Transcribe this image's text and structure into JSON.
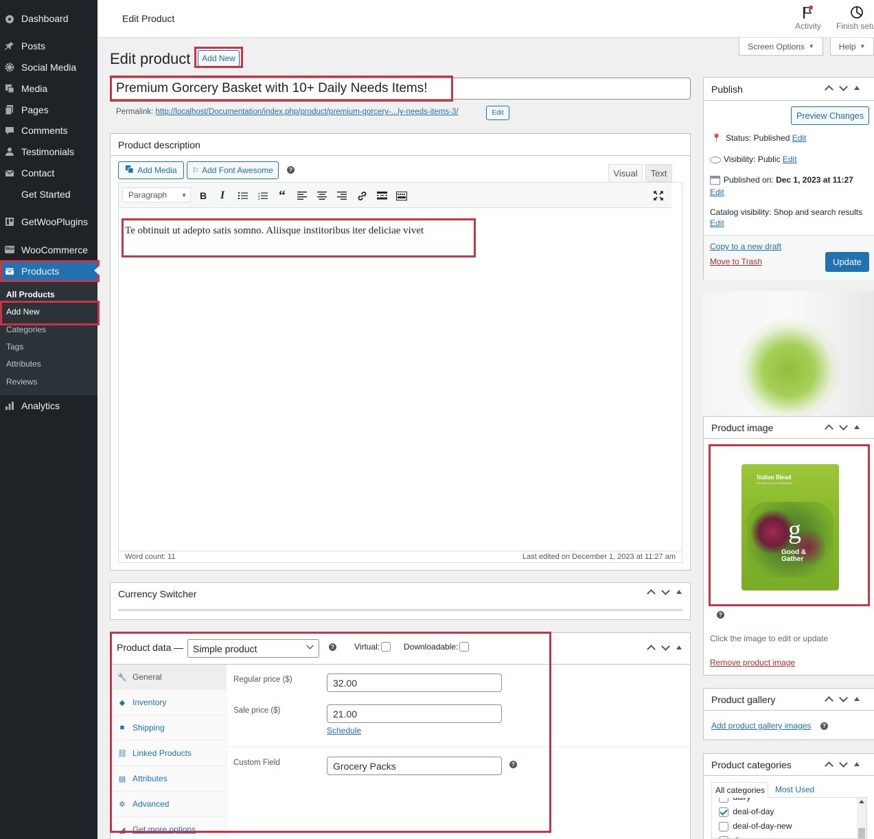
{
  "sidebar": {
    "items": [
      {
        "label": "Dashboard",
        "icon": "dashboard-icon"
      },
      {
        "label": "Posts",
        "icon": "pin-icon"
      },
      {
        "label": "Social Media",
        "icon": "gear-icon"
      },
      {
        "label": "Media",
        "icon": "media-icon"
      },
      {
        "label": "Pages",
        "icon": "page-icon"
      },
      {
        "label": "Comments",
        "icon": "comment-icon"
      },
      {
        "label": "Testimonials",
        "icon": "user-icon"
      },
      {
        "label": "Contact",
        "icon": "mail-icon"
      },
      {
        "label": "Get Started",
        "icon": ""
      },
      {
        "label": "GetWooPlugins",
        "icon": "plugin-icon"
      },
      {
        "label": "WooCommerce",
        "icon": "woo-icon"
      },
      {
        "label": "Products",
        "icon": "archive-icon"
      },
      {
        "label": "Analytics",
        "icon": "bar-chart-icon"
      }
    ],
    "submenu": [
      "All Products",
      "Add New",
      "Categories",
      "Tags",
      "Attributes",
      "Reviews"
    ],
    "woo_badge": "Woo"
  },
  "topbar": {
    "title": "Edit Product",
    "activity": "Activity",
    "finish_setup": "Finish setu"
  },
  "screen_options": "Screen Options",
  "help": "Help",
  "page": {
    "heading": "Edit product",
    "add_new": "Add New",
    "product_title": "Premium Gorcery Basket with 10+ Daily Needs Items!",
    "permalink_label": "Permalink:",
    "permalink_url": "http://localhost/Documentation/index.php/product/premium-gorcery-...ly-needs-items-3/",
    "permalink_edit": "Edit"
  },
  "description": {
    "title": "Product description",
    "add_media": "Add Media",
    "add_font_awesome": "Add Font Awesome",
    "tab_visual": "Visual",
    "tab_text": "Text",
    "format_select": "Paragraph",
    "content": "Te obtinuit ut adepto satis somno. Aliisque institoribus iter deliciae vivet",
    "word_count": "Word count: 11",
    "last_edited": "Last edited on December 1, 2023 at 11:27 am"
  },
  "currency_switcher": {
    "title": "Currency Switcher"
  },
  "product_data": {
    "title": "Product data —",
    "type": "Simple product",
    "virtual_label": "Virtual:",
    "downloadable_label": "Downloadable:",
    "tabs": [
      {
        "label": "General",
        "icon": "wrench-icon"
      },
      {
        "label": "Inventory",
        "icon": "tag-icon"
      },
      {
        "label": "Shipping",
        "icon": "truck-icon"
      },
      {
        "label": "Linked Products",
        "icon": "link-icon"
      },
      {
        "label": "Attributes",
        "icon": "list-icon"
      },
      {
        "label": "Advanced",
        "icon": "gear-icon"
      },
      {
        "label": "Get more options",
        "icon": "plugin-icon"
      }
    ],
    "regular_price_label": "Regular price ($)",
    "regular_price": "32.00",
    "sale_price_label": "Sale price ($)",
    "sale_price": "21.00",
    "schedule": "Schedule",
    "custom_field_label": "Custom Field",
    "custom_field": "Grocery Packs"
  },
  "publish": {
    "title": "Publish",
    "preview": "Preview Changes",
    "status_label": "Status:",
    "status": "Published",
    "visibility_label": "Visibility:",
    "visibility": "Public",
    "published_on_label": "Published on:",
    "published_on": "Dec 1, 2023 at 11:27",
    "catalog_label": "Catalog visibility:",
    "catalog": "Shop and search results",
    "edit": "Edit",
    "copy_draft": "Copy to a new draft",
    "trash": "Move to Trash",
    "update": "Update"
  },
  "product_image": {
    "title": "Product image",
    "package_brand": "Italian Blend",
    "package_sub": "Romaine Lettuce & Radicchio",
    "package_logo": "Good & Gather",
    "hint": "Click the image to edit or update",
    "remove": "Remove product image"
  },
  "gallery": {
    "title": "Product gallery",
    "add": "Add product gallery images"
  },
  "categories": {
    "title": "Product categories",
    "tab_all": "All categories",
    "tab_used": "Most Used",
    "items": [
      {
        "label": "dairy",
        "checked": false
      },
      {
        "label": "deal-of-day",
        "checked": true
      },
      {
        "label": "deal-of-day-new",
        "checked": false
      },
      {
        "label": "dinner",
        "checked": false
      }
    ]
  },
  "colors": {
    "accent": "#2271b1",
    "sidebar": "#1d2327",
    "highlight": "#c93545"
  }
}
